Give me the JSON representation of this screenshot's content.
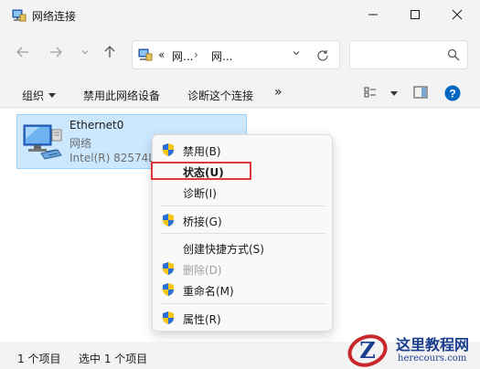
{
  "window": {
    "title": "网络连接",
    "controls": {
      "minimize": "—",
      "maximize": "☐",
      "close": "✕"
    }
  },
  "nav": {
    "back_icon": "arrow-left-icon",
    "forward_icon": "arrow-right-icon",
    "recent_icon": "chevron-down-icon",
    "up_icon": "arrow-up-icon"
  },
  "address": {
    "prefix": "«",
    "crumb1": "网...",
    "separator": "›",
    "crumb2": "网...",
    "refresh_icon": "refresh-icon"
  },
  "search": {
    "placeholder": "",
    "icon": "search-icon"
  },
  "toolbar": {
    "organize": "组织",
    "disable_device": "禁用此网络设备",
    "diagnose": "诊断这个连接",
    "more": "»"
  },
  "connection": {
    "name": "Ethernet0",
    "status": "网络",
    "device": "Intel(R) 82574L"
  },
  "context_menu": {
    "items": [
      {
        "label": "禁用(B)",
        "shield": true
      },
      {
        "label": "状态(U)",
        "shield": false,
        "bold": true,
        "highlighted": true
      },
      {
        "label": "诊断(I)",
        "shield": false
      },
      {
        "label": "桥接(G)",
        "shield": true
      },
      {
        "label": "创建快捷方式(S)",
        "shield": false
      },
      {
        "label": "删除(D)",
        "shield": true,
        "disabled": true
      },
      {
        "label": "重命名(M)",
        "shield": true
      },
      {
        "label": "属性(R)",
        "shield": true
      }
    ]
  },
  "statusbar": {
    "item_count": "1 个项目",
    "selected_count": "选中 1 个项目"
  },
  "watermark": {
    "title": "这里教程网",
    "url": "herecours.com"
  },
  "colors": {
    "selection": "#cce8ff",
    "highlight_border": "#e0383a",
    "help_blue": "#0067c0"
  }
}
